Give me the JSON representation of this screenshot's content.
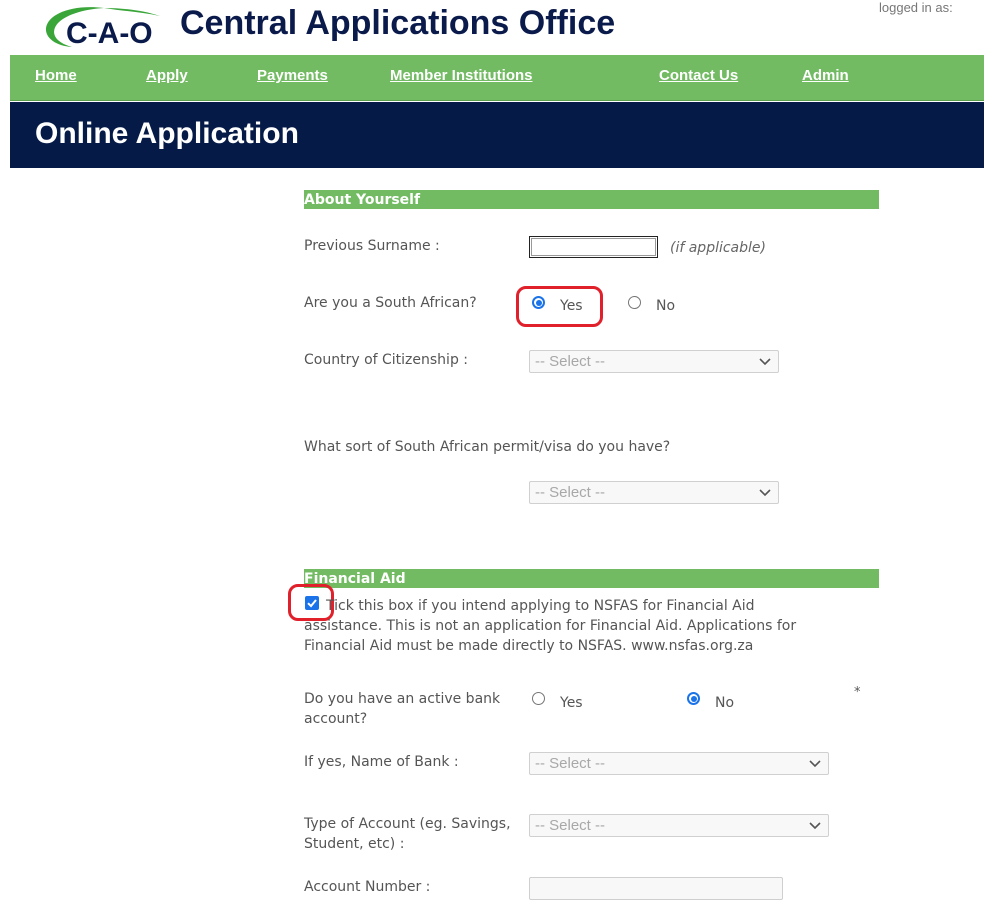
{
  "header": {
    "logo_text": "C-A-O",
    "site_title": "Central Applications Office",
    "logged_in": "logged in as:"
  },
  "nav": {
    "home": "Home",
    "apply": "Apply",
    "payments": "Payments",
    "member_institutions": "Member Institutions",
    "contact_us": "Contact Us",
    "admin": "Admin"
  },
  "page_title": "Online Application",
  "about": {
    "section_title": "About Yourself",
    "previous_surname_label": "Previous Surname :",
    "previous_surname_value": "",
    "previous_surname_hint": "(if applicable)",
    "south_african_label": "Are you a South African?",
    "south_african_yes": "Yes",
    "south_african_no": "No",
    "south_african_selected": "Yes",
    "citizenship_label": "Country of Citizenship :",
    "citizenship_value": "-- Select --",
    "permit_label": "What sort of South African permit/visa do you have?",
    "permit_value": "-- Select --"
  },
  "financial": {
    "section_title": "Financial Aid",
    "nsfas_text": "Tick this box if you intend applying to NSFAS for Financial Aid assistance. This is not an application for Financial Aid. Applications for Financial Aid must be made directly to NSFAS. www.nsfas.org.za",
    "nsfas_checked": true,
    "bank_account_label": "Do you have an active bank account?",
    "bank_account_yes": "Yes",
    "bank_account_no": "No",
    "bank_account_selected": "No",
    "required_marker": "*",
    "bank_name_label": "If yes, Name of Bank :",
    "bank_name_value": "-- Select --",
    "account_type_label": "Type of Account (eg. Savings, Student, etc) :",
    "account_type_value": "-- Select --",
    "account_number_label": "Account Number :",
    "account_number_value": ""
  },
  "colors": {
    "nav_green": "#72bb63",
    "title_navy": "#051a46",
    "highlight_red": "#e0202a",
    "radio_blue": "#1a73e8"
  }
}
